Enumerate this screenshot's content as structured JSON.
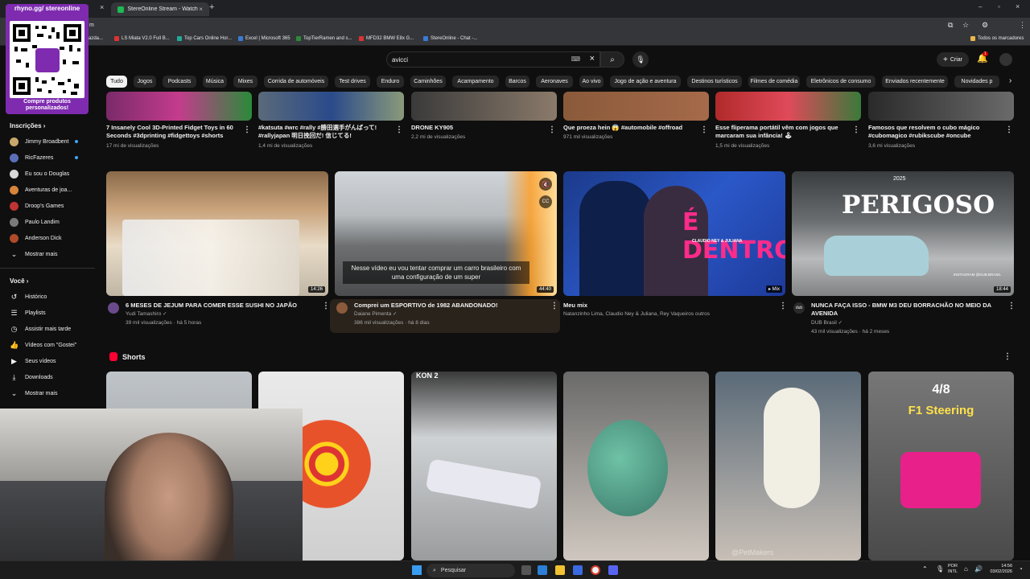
{
  "browser": {
    "tab_close_glyph": "×",
    "active_tab_title": "StereOnline Stream - Watch Li",
    "new_tab_glyph": "+",
    "url_fragment": "m",
    "bookmarks": [
      "azda...",
      "LS Miata V2.0 Full B...",
      "Top Cars Online Hor...",
      "Excel | Microsoft 365",
      "TopTierRamen and s...",
      "MFD32 BMW E8x G...",
      "StereOnline - Chat -..."
    ],
    "all_bookmarks_label": "Todos os marcadores"
  },
  "youtube": {
    "search_value": "avicci",
    "create_label": "Criar",
    "notification_count": "1"
  },
  "chips": [
    "Tudo",
    "Jogos",
    "Podcasts",
    "Música",
    "Mixes",
    "Corrida de automóveis",
    "Test drives",
    "Enduro",
    "Caminhões",
    "Acampamento",
    "Barcos",
    "Aeronaves",
    "Ao vivo",
    "Jogo de ação e aventura",
    "Destinos turísticos",
    "Filmes de comédia",
    "Eletrônicos de consumo",
    "Enviados recentemente",
    "Novidades p"
  ],
  "sidebar": {
    "subs_header": "Inscrições",
    "subscriptions": [
      {
        "name": "Jimmy Broadbent",
        "color": "#c8a86a"
      },
      {
        "name": "RicFazeres",
        "color": "#5a6fb8"
      },
      {
        "name": "Eu sou o Douglas",
        "color": "#d9d9d9"
      },
      {
        "name": "Aventuras de joa...",
        "color": "#d8843a"
      },
      {
        "name": "Droop's Games",
        "color": "#c03434"
      },
      {
        "name": "Paulo Landim",
        "color": "#7a7a7a"
      },
      {
        "name": "Anderson Dick",
        "color": "#b04a2a"
      }
    ],
    "show_more": "Mostrar mais",
    "you_header": "Você",
    "you_items": [
      {
        "label": "Histórico",
        "icon": "history-icon"
      },
      {
        "label": "Playlists",
        "icon": "playlists-icon"
      },
      {
        "label": "Assistir mais tarde",
        "icon": "watch-later-icon"
      },
      {
        "label": "Vídeos com \"Gostei\"",
        "icon": "liked-icon"
      },
      {
        "label": "Seus vídeos",
        "icon": "your-videos-icon"
      },
      {
        "label": "Downloads",
        "icon": "downloads-icon"
      }
    ],
    "show_more_2": "Mostrar mais"
  },
  "top_row": [
    {
      "title": "7 Insanely Cool 3D-Printed Fidget Toys in 60 Seconds #3dprinting #fidgettoys #shorts",
      "meta": "17 mi de visualizações"
    },
    {
      "title": "#katsuta #wrc #rally #勝田選手がんばって! #rallyjapan 明日挽回だ! 信じてる!",
      "meta": "1,4 mi de visualizações"
    },
    {
      "title": "DRONE KY905",
      "meta": "2,2 mi de visualizações"
    },
    {
      "title": "Que proeza hein 😱 #automobile #offroad",
      "meta": "971 mil visualizações"
    },
    {
      "title": "Esse fliperama portátil vêm com jogos que marcaram sua infância! 🕹",
      "meta": "1,5 mi de visualizações"
    },
    {
      "title": "Famosos que resolvem o cubo mágico #cubomagico #rubikscube #oncube",
      "meta": "3,6 mi visualizações"
    }
  ],
  "videos": [
    {
      "title": "6 MESES DE JEJUM PARA COMER ESSE SUSHI NO JAPÃO",
      "channel": "Yudi Tamashiro",
      "meta": "39 mil visualizações · há 5 horas",
      "duration": "14:26"
    },
    {
      "title": "Comprei um ESPORTIVO de 1982 ABANDONADO!",
      "channel": "Daiane Pimenta",
      "meta": "386 mil visualizações · há 8 dias",
      "duration": "44:40",
      "caption": "Nesse vídeo eu vou tentar comprar um carro brasileiro com uma configuração de um super"
    },
    {
      "title": "Meu mix",
      "channel": "Natanzinho Lima, Claudio Ney & Juliana, Rey Vaqueiros outros",
      "meta": "",
      "duration": "Mix",
      "overlay_text": "É DENTRO",
      "overlay_sub": "CLAUDIO NEY & JULIANA"
    },
    {
      "title": "NUNCA FAÇA ISSO - BMW M3 DEU BORRACHÃO NO MEIO DA AVENIDA",
      "channel": "DUB Brasil",
      "meta": "43 mil visualizações · há 2 meses",
      "duration": "18:44",
      "overlay_text": "PERIGOSO",
      "overlay_year": "2025",
      "overlay_ig": "INSTAGRAM @DUB.BRASIL"
    }
  ],
  "shorts": {
    "header": "Shorts",
    "items": [
      {
        "text": ""
      },
      {
        "text": ""
      },
      {
        "text": "KON 2"
      },
      {
        "text": ""
      },
      {
        "text": "@PetMakers"
      },
      {
        "text": "4/8",
        "text2": "F1 Steering"
      }
    ]
  },
  "overlay": {
    "qr_top": "rhyno.gg/ stereonline",
    "qr_bottom": "Compre produtos personalizados!"
  },
  "taskbar": {
    "search_label": "Pesquisar",
    "lang_top": "POR",
    "lang_bottom": "INTL",
    "time": "14:56",
    "date": "03/02/2026"
  }
}
